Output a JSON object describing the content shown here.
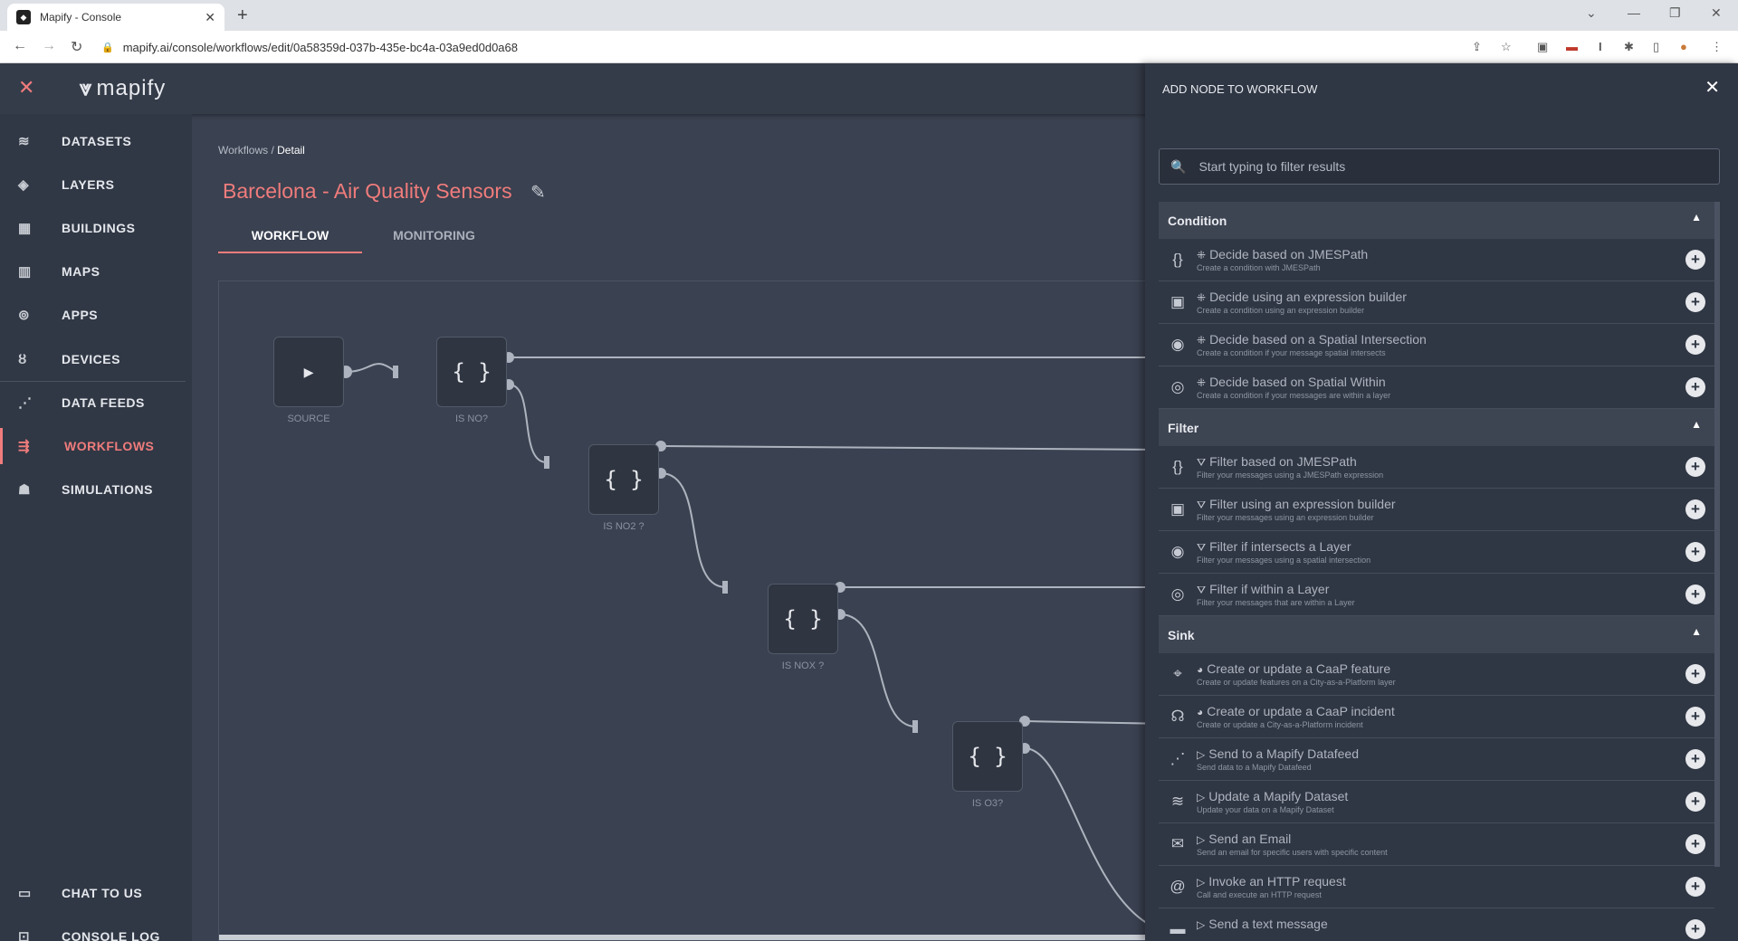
{
  "browser": {
    "tab_title": "Mapify - Console",
    "url": "mapify.ai/console/workflows/edit/0a58359d-037b-435e-bc4a-03a9ed0d0a68"
  },
  "app": {
    "logo_text": "mapify",
    "accent_color": "#f07c7c"
  },
  "sidebar": {
    "items": [
      {
        "label": "DATASETS",
        "icon": "database-icon"
      },
      {
        "label": "LAYERS",
        "icon": "layers-icon"
      },
      {
        "label": "BUILDINGS",
        "icon": "buildings-icon"
      },
      {
        "label": "MAPS",
        "icon": "map-icon"
      },
      {
        "label": "APPS",
        "icon": "apps-icon"
      },
      {
        "label": "DEVICES",
        "icon": "devices-icon"
      },
      {
        "label": "DATA FEEDS",
        "icon": "rss-icon"
      },
      {
        "label": "WORKFLOWS",
        "icon": "workflow-icon",
        "active": true
      },
      {
        "label": "SIMULATIONS",
        "icon": "robot-icon"
      }
    ],
    "bottom": [
      {
        "label": "CHAT TO US",
        "icon": "chat-icon"
      },
      {
        "label": "CONSOLE LOG",
        "icon": "terminal-icon"
      }
    ]
  },
  "main": {
    "breadcrumb": {
      "parent": "Workflows",
      "separator": " / ",
      "current": "Detail"
    },
    "title": "Barcelona - Air Quality Sensors",
    "tabs": [
      {
        "label": "WORKFLOW",
        "active": true
      },
      {
        "label": "MONITORING",
        "active": false
      }
    ],
    "nodes": [
      {
        "label": "SOURCE",
        "glyph": "▶"
      },
      {
        "label": "IS NO?",
        "glyph": "{ }"
      },
      {
        "label": "IS NO2 ?",
        "glyph": "{ }"
      },
      {
        "label": "IS NOX ?",
        "glyph": "{ }"
      },
      {
        "label": "IS O3?",
        "glyph": "{ }"
      }
    ]
  },
  "panel": {
    "title": "ADD NODE TO WORKFLOW",
    "search_placeholder": "Start typing to filter results",
    "sections": [
      {
        "name": "Condition",
        "items": [
          {
            "prefix": "⁜",
            "title": "Decide based on JMESPath",
            "desc": "Create a condition with JMESPath",
            "icon": "braces-icon"
          },
          {
            "prefix": "⁜",
            "title": "Decide using an expression builder",
            "desc": "Create a condition using an expression builder",
            "icon": "grid-plus-icon"
          },
          {
            "prefix": "⁜",
            "title": "Decide based on a Spatial Intersection",
            "desc": "Create a condition if your message spatial intersects",
            "icon": "intersect-icon"
          },
          {
            "prefix": "⁜",
            "title": "Decide based on Spatial Within",
            "desc": "Create a condition if your messages are within a layer",
            "icon": "within-icon"
          }
        ]
      },
      {
        "name": "Filter",
        "items": [
          {
            "prefix": "⛛",
            "title": "Filter based on JMESPath",
            "desc": "Filter your messages using a JMESPath expression",
            "icon": "braces-icon"
          },
          {
            "prefix": "⛛",
            "title": "Filter using an expression builder",
            "desc": "Filter your messages using an expression builder",
            "icon": "grid-plus-icon"
          },
          {
            "prefix": "⛛",
            "title": "Filter if intersects a Layer",
            "desc": "Filter your messages using a spatial intersection",
            "icon": "intersect-icon"
          },
          {
            "prefix": "⛛",
            "title": "Filter if within a Layer",
            "desc": "Filter your messages that are within a Layer",
            "icon": "within-icon"
          }
        ]
      },
      {
        "name": "Sink",
        "items": [
          {
            "prefix": "◕",
            "title": "Create or update a CaaP feature",
            "desc": "Create or update features on a City-as-a-Platform layer",
            "icon": "location-plus-icon"
          },
          {
            "prefix": "◕",
            "title": "Create or update a CaaP incident",
            "desc": "Create or update a City-as-a-Platform incident",
            "icon": "incident-icon"
          },
          {
            "prefix": "▷",
            "title": "Send to a Mapify Datafeed",
            "desc": "Send data to a Mapify Datafeed",
            "icon": "rss-icon"
          },
          {
            "prefix": "▷",
            "title": "Update a Mapify Dataset",
            "desc": "Update your data on a Mapify Dataset",
            "icon": "database-icon"
          },
          {
            "prefix": "▷",
            "title": "Send an Email",
            "desc": "Send an email for specific users with specific content",
            "icon": "mail-icon"
          },
          {
            "prefix": "▷",
            "title": "Invoke an HTTP request",
            "desc": "Call and execute an HTTP request",
            "icon": "at-icon"
          },
          {
            "prefix": "▷",
            "title": "Send a text message",
            "desc": "",
            "icon": "message-icon"
          }
        ]
      }
    ]
  }
}
